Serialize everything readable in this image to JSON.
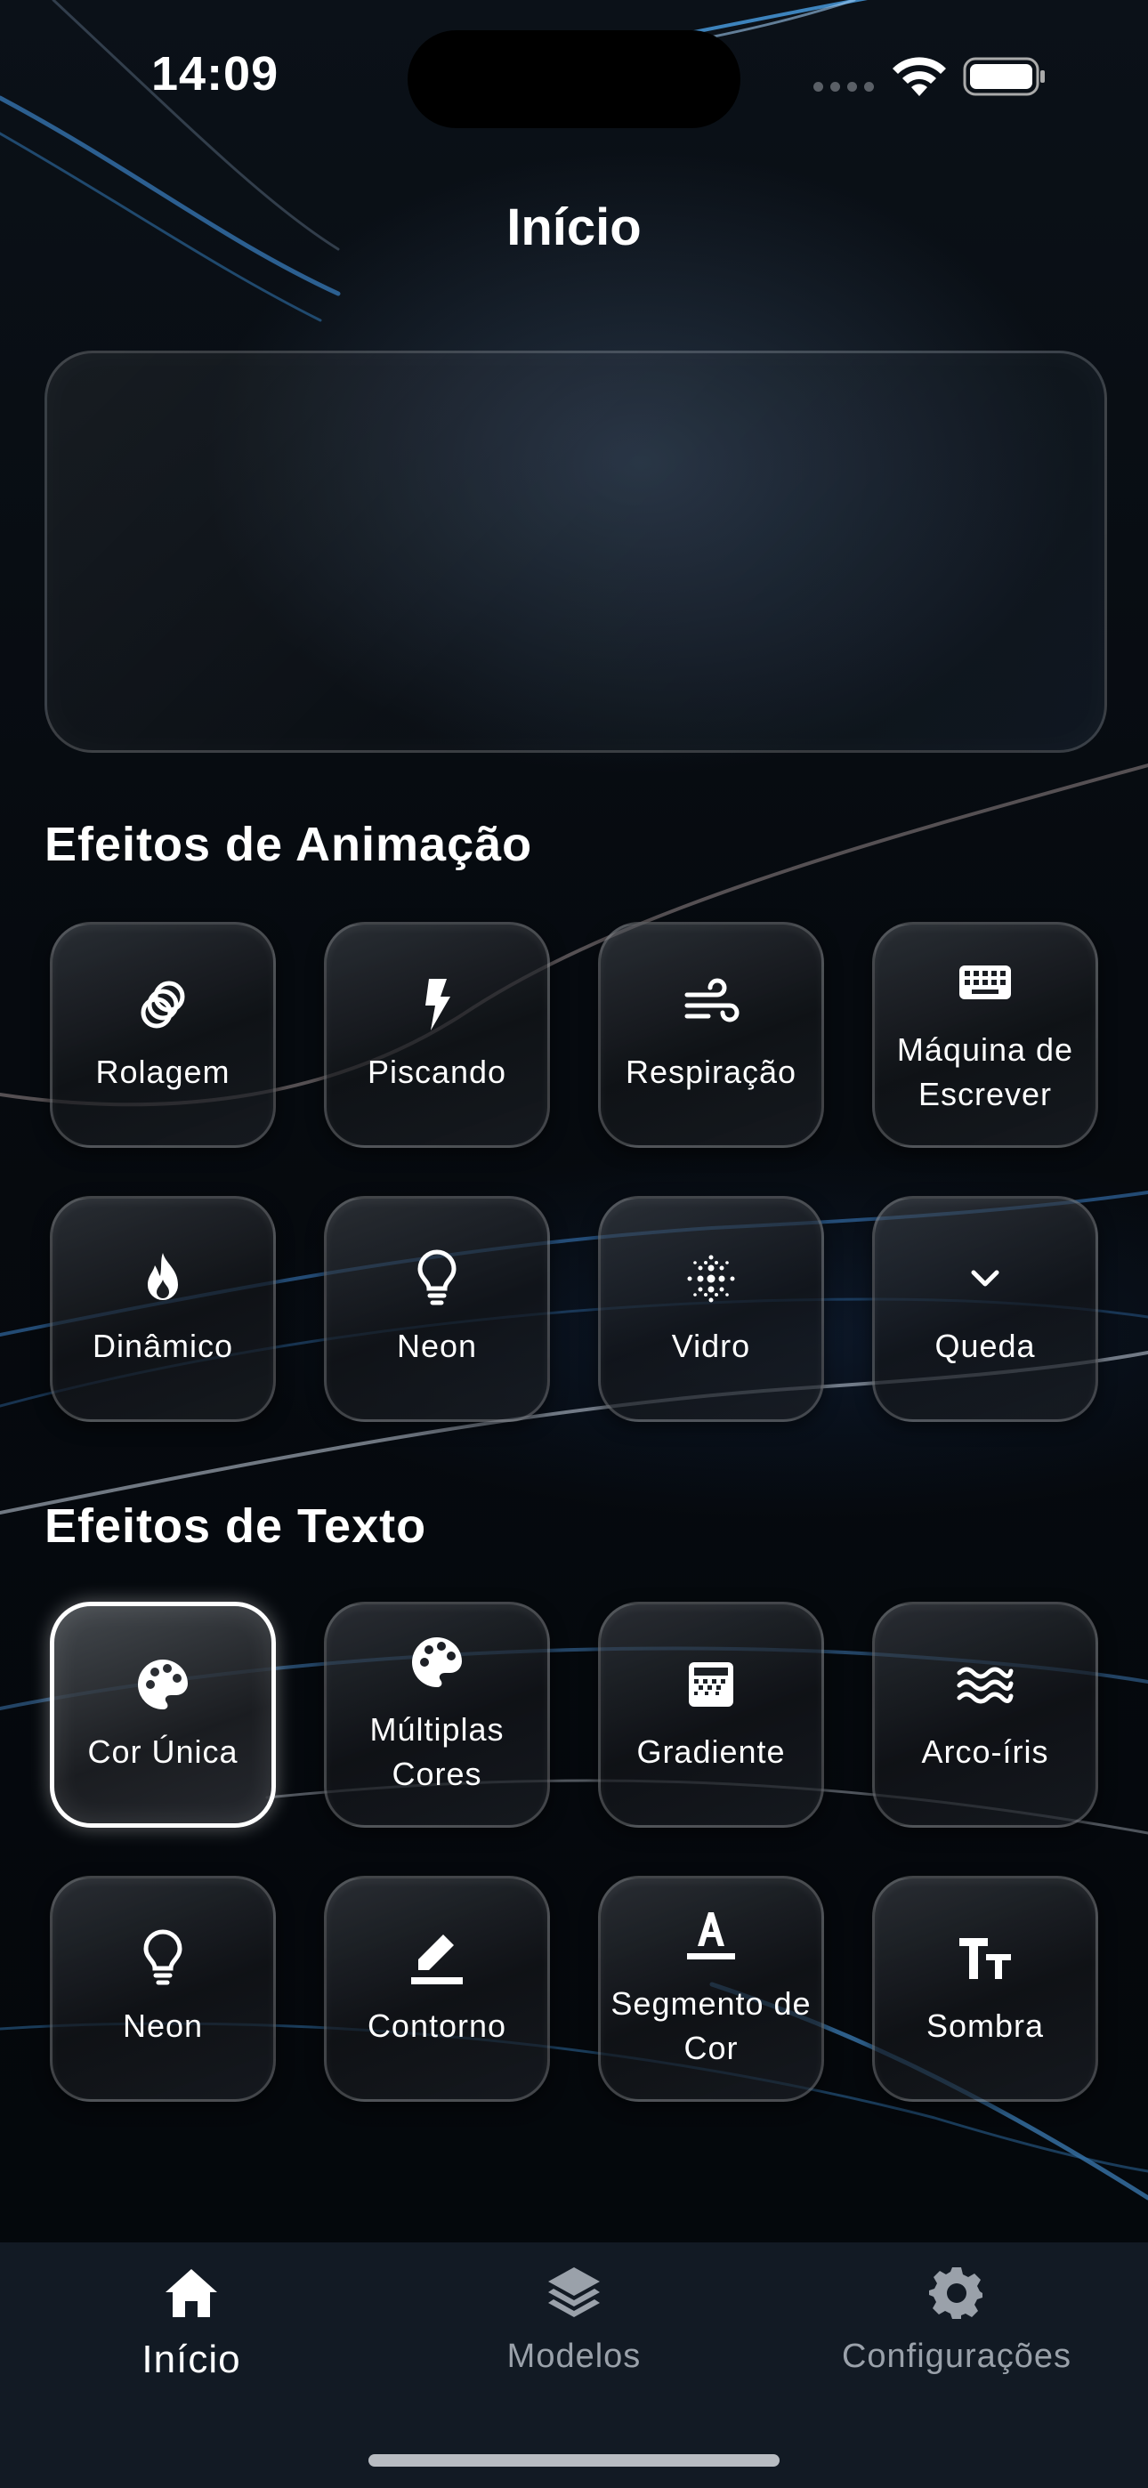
{
  "status_bar": {
    "time": "14:09"
  },
  "nav": {
    "title": "Início"
  },
  "sections": [
    {
      "title": "Efeitos de Animação",
      "items": [
        {
          "label": "Rolagem",
          "icon": "rings-icon"
        },
        {
          "label": "Piscando",
          "icon": "lightning-icon"
        },
        {
          "label": "Respiração",
          "icon": "wind-icon"
        },
        {
          "label": "Máquina de\nEscrever",
          "icon": "keyboard-icon"
        },
        {
          "label": "Dinâmico",
          "icon": "fire-icon"
        },
        {
          "label": "Neon",
          "icon": "lightbulb-icon"
        },
        {
          "label": "Vidro",
          "icon": "dots-grid-icon"
        },
        {
          "label": "Queda",
          "icon": "chevron-down-icon"
        }
      ]
    },
    {
      "title": "Efeitos de Texto",
      "items": [
        {
          "label": "Cor Única",
          "icon": "palette-icon",
          "selected": true
        },
        {
          "label": "Múltiplas\nCores",
          "icon": "palette-icon"
        },
        {
          "label": "Gradiente",
          "icon": "gradient-icon"
        },
        {
          "label": "Arco-íris",
          "icon": "waves-icon"
        },
        {
          "label": "Neon",
          "icon": "lightbulb-icon"
        },
        {
          "label": "Contorno",
          "icon": "pen-outline-icon"
        },
        {
          "label": "Segmento de\nCor",
          "icon": "text-underline-icon"
        },
        {
          "label": "Sombra",
          "icon": "text-size-icon"
        }
      ]
    }
  ],
  "tab_bar": [
    {
      "label": "Início",
      "icon": "home-icon",
      "active": true
    },
    {
      "label": "Modelos",
      "icon": "layers-icon",
      "active": false
    },
    {
      "label": "Configurações",
      "icon": "gear-icon",
      "active": false
    }
  ]
}
